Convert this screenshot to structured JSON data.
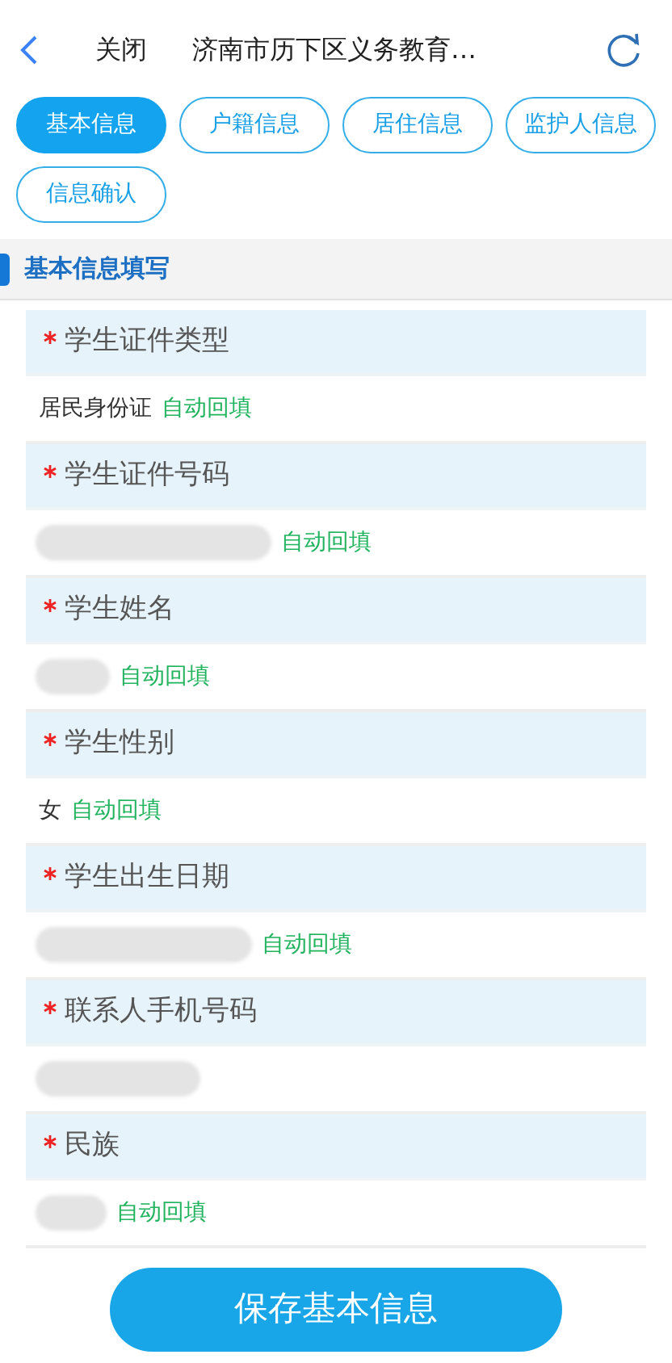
{
  "header": {
    "close": "关闭",
    "title": "济南市历下区义务教育…"
  },
  "tabs": [
    {
      "label": "基本信息",
      "selected": true
    },
    {
      "label": "户籍信息",
      "selected": false
    },
    {
      "label": "居住信息",
      "selected": false
    },
    {
      "label": "监护人信息",
      "selected": false
    },
    {
      "label": "信息确认",
      "selected": false
    }
  ],
  "section": {
    "title": "基本信息填写"
  },
  "fields": [
    {
      "label": "学生证件类型",
      "required": true,
      "value": {
        "kind": "text",
        "text": "居民身份证"
      },
      "note": "自动回填"
    },
    {
      "label": "学生证件号码",
      "required": true,
      "value": {
        "kind": "redacted"
      },
      "note": "自动回填"
    },
    {
      "label": "学生姓名",
      "required": true,
      "value": {
        "kind": "redacted"
      },
      "note": "自动回填"
    },
    {
      "label": "学生性别",
      "required": true,
      "value": {
        "kind": "text",
        "text": "女"
      },
      "note": "自动回填"
    },
    {
      "label": "学生出生日期",
      "required": true,
      "value": {
        "kind": "redacted"
      },
      "note": "自动回填"
    },
    {
      "label": "联系人手机号码",
      "required": true,
      "value": {
        "kind": "redacted"
      }
    },
    {
      "label": "民族",
      "required": true,
      "value": {
        "kind": "redacted"
      },
      "note": "自动回填"
    }
  ],
  "save_button": "保存基本信息"
}
